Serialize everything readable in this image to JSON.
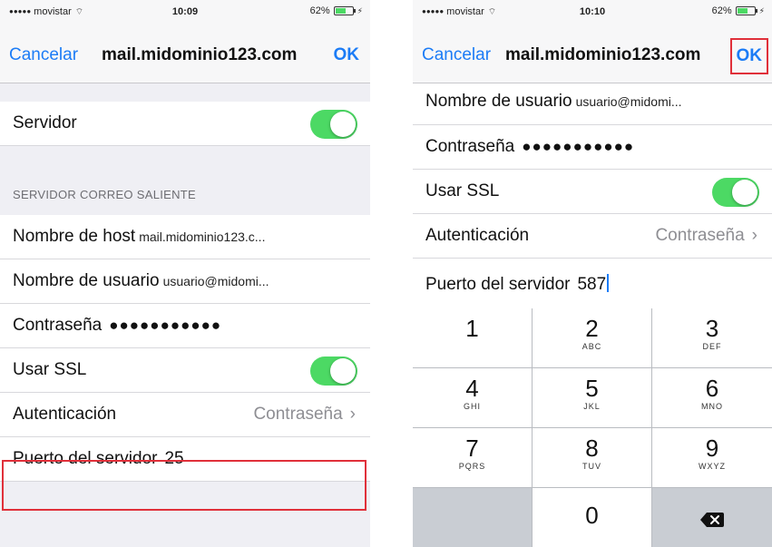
{
  "left": {
    "status": {
      "carrier": "movistar",
      "time": "10:09",
      "battery": "62%"
    },
    "nav": {
      "cancel": "Cancelar",
      "title": "mail.midominio123.com",
      "ok": "OK"
    },
    "server_row": {
      "label": "Servidor",
      "toggle_on": true
    },
    "section_header": "SERVIDOR CORREO SALIENTE",
    "rows": {
      "host_label": "Nombre de host",
      "host_value": "mail.midominio123.c...",
      "user_label": "Nombre de usuario",
      "user_value": "usuario@midomi...",
      "password_label": "Contraseña",
      "password_value": "●●●●●●●●●●●",
      "ssl_label": "Usar SSL",
      "ssl_on": true,
      "auth_label": "Autenticación",
      "auth_value": "Contraseña",
      "port_label": "Puerto del servidor",
      "port_value": "25"
    }
  },
  "right": {
    "status": {
      "carrier": "movistar",
      "time": "10:10",
      "battery": "62%"
    },
    "nav": {
      "cancel": "Cancelar",
      "title": "mail.midominio123.com",
      "ok": "OK"
    },
    "rows": {
      "user_label": "Nombre de usuario",
      "user_value": "usuario@midomi...",
      "password_label": "Contraseña",
      "password_value": "●●●●●●●●●●●",
      "ssl_label": "Usar SSL",
      "ssl_on": true,
      "auth_label": "Autenticación",
      "auth_value": "Contraseña",
      "port_label": "Puerto del servidor",
      "port_value": "587"
    },
    "keypad": [
      {
        "num": "1",
        "letters": ""
      },
      {
        "num": "2",
        "letters": "ABC"
      },
      {
        "num": "3",
        "letters": "DEF"
      },
      {
        "num": "4",
        "letters": "GHI"
      },
      {
        "num": "5",
        "letters": "JKL"
      },
      {
        "num": "6",
        "letters": "MNO"
      },
      {
        "num": "7",
        "letters": "PQRS"
      },
      {
        "num": "8",
        "letters": "TUV"
      },
      {
        "num": "9",
        "letters": "WXYZ"
      },
      {
        "num": "0",
        "letters": ""
      }
    ]
  },
  "colors": {
    "accent": "#1c7cf6",
    "toggle_on": "#4cd964",
    "highlight": "#e0303a"
  }
}
